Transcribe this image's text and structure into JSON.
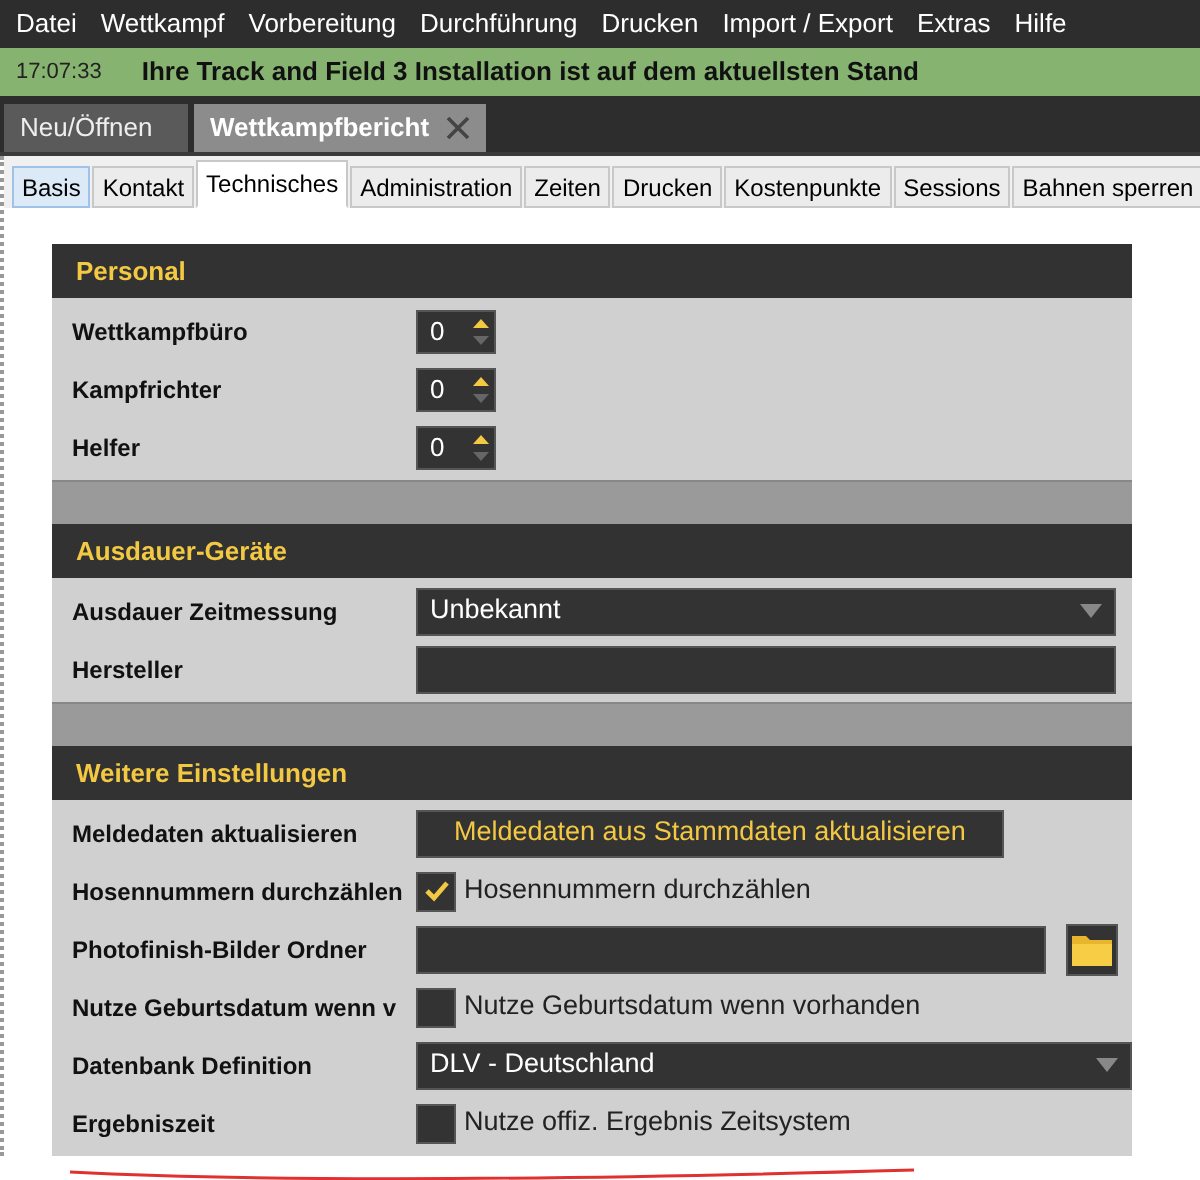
{
  "menu": [
    "Datei",
    "Wettkampf",
    "Vorbereitung",
    "Durchführung",
    "Drucken",
    "Import / Export",
    "Extras",
    "Hilfe"
  ],
  "status_bar": {
    "time": "17:07:33",
    "message": "Ihre Track and Field 3 Installation ist auf dem aktuellsten Stand"
  },
  "document_tabs": [
    {
      "label": "Neu/Öffnen",
      "selected": false,
      "closable": false
    },
    {
      "label": "Wettkampfbericht",
      "selected": true,
      "closable": true
    }
  ],
  "tabs": [
    {
      "label": "Basis",
      "selected": false,
      "highlighted": true
    },
    {
      "label": "Kontakt",
      "selected": false,
      "highlighted": false
    },
    {
      "label": "Technisches",
      "selected": true,
      "highlighted": false
    },
    {
      "label": "Administration",
      "selected": false,
      "highlighted": false
    },
    {
      "label": "Zeiten",
      "selected": false,
      "highlighted": false
    },
    {
      "label": "Drucken",
      "selected": false,
      "highlighted": false
    },
    {
      "label": "Kostenpunkte",
      "selected": false,
      "highlighted": false
    },
    {
      "label": "Sessions",
      "selected": false,
      "highlighted": false
    },
    {
      "label": "Bahnen sperren",
      "selected": false,
      "highlighted": false
    }
  ],
  "sections": [
    {
      "title": "Personal",
      "rows": [
        {
          "label": "Wettkampfbüro",
          "kind": "spinner",
          "value": "0"
        },
        {
          "label": "Kampfrichter",
          "kind": "spinner",
          "value": "0"
        },
        {
          "label": "Helfer",
          "kind": "spinner",
          "value": "0"
        }
      ]
    },
    {
      "title": "Ausdauer-Geräte",
      "rows": [
        {
          "label": "Ausdauer Zeitmessung",
          "kind": "dropdown",
          "value": "Unbekannt"
        },
        {
          "label": "Hersteller",
          "kind": "textbox"
        }
      ]
    },
    {
      "title": "Weitere Einstellungen",
      "rows": [
        {
          "label": "Meldedaten aktualisieren",
          "kind": "button",
          "text": "Meldedaten aus Stammdaten aktualisieren"
        },
        {
          "label": "Hosennummern durchzählen",
          "kind": "checkbox",
          "text": "Hosennummern durchzählen",
          "checked": true
        },
        {
          "label": "Photofinish-Bilder Ordner",
          "kind": "folder"
        },
        {
          "label": "Nutze Geburtsdatum wenn v",
          "kind": "checkbox",
          "text": "Nutze Geburtsdatum wenn vorhanden",
          "checked": false
        },
        {
          "label": "Datenbank Definition",
          "kind": "dropdown",
          "value": "DLV - Deutschland",
          "wide": true
        },
        {
          "label": "Ergebniszeit",
          "kind": "checkbox",
          "text": "Nutze offiz. Ergebnis Zeitsystem",
          "checked": false
        }
      ]
    }
  ]
}
